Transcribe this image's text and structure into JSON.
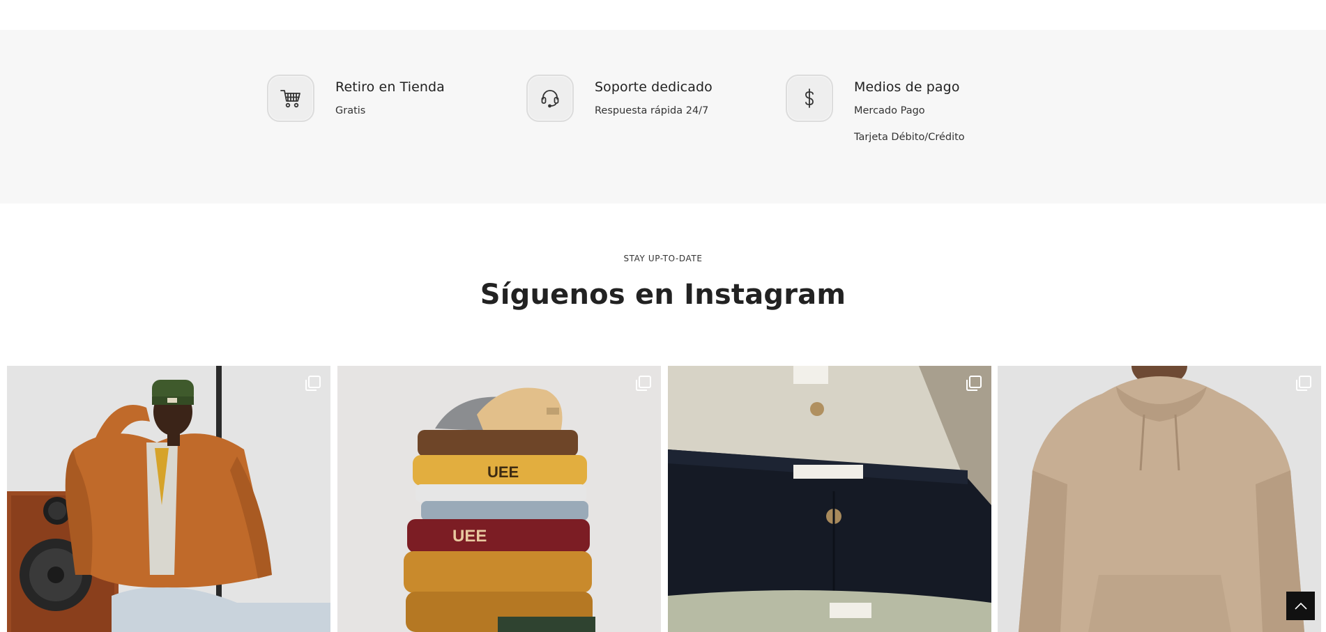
{
  "features": [
    {
      "icon": "shopping-cart-icon",
      "title": "Retiro en Tienda",
      "lines": [
        "Gratis"
      ]
    },
    {
      "icon": "headset-icon",
      "title": "Soporte dedicado",
      "lines": [
        "Respuesta rápida 24/7"
      ]
    },
    {
      "icon": "dollar-icon",
      "title": "Medios de pago",
      "lines": [
        "Mercado Pago",
        "Tarjeta Débito/Crédito"
      ]
    }
  ],
  "instagram": {
    "eyebrow": "STAY UP-TO-DATE",
    "title": "Síguenos en Instagram",
    "posts": [
      {
        "icon": "multiple-images-icon"
      },
      {
        "icon": "multiple-images-icon"
      },
      {
        "icon": "multiple-images-icon"
      },
      {
        "icon": "multiple-images-icon"
      }
    ]
  },
  "back_to_top": {
    "icon": "chevron-up-icon"
  }
}
